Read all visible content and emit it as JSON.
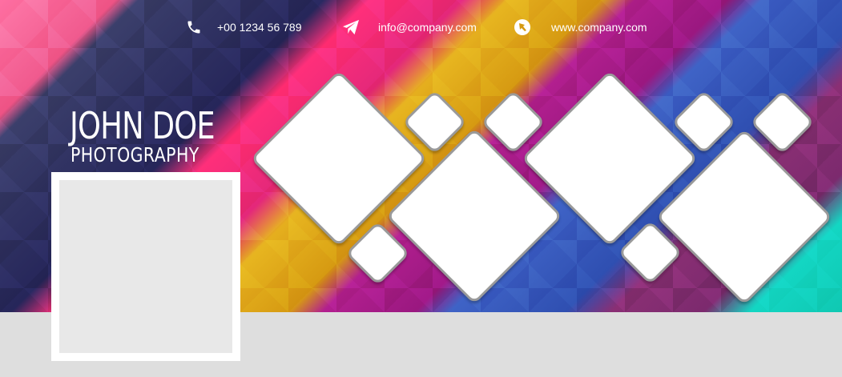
{
  "contact": {
    "phone": "+00 1234 56 789",
    "email": "info@company.com",
    "website": "www.company.com"
  },
  "brand": {
    "name": "JOHN DOE",
    "tagline": "PHOTOGRAPHY"
  },
  "icons": {
    "phone": "phone-icon",
    "email": "paper-plane-icon",
    "website": "globe-icon"
  },
  "colors": {
    "text": "#ffffff",
    "frame": "#ffffff",
    "placeholder": "#e8e8e8",
    "bottom_bar": "#dedede",
    "diamond_border": "#9a9a9a"
  }
}
